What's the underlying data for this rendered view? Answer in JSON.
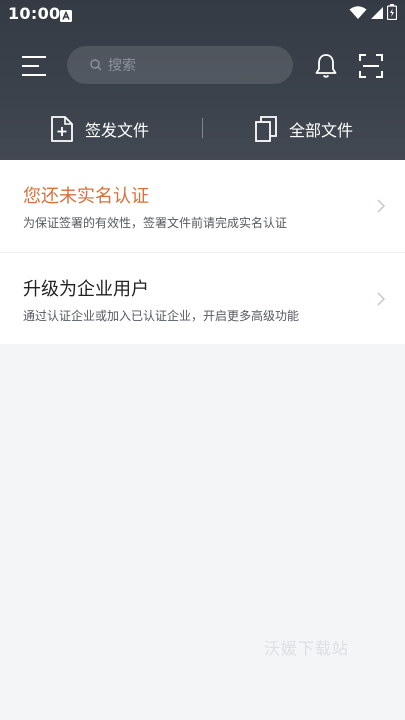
{
  "status_bar": {
    "time": "10:00",
    "icons": [
      "app-notification-icon",
      "wifi-icon",
      "signal-icon",
      "battery-icon"
    ]
  },
  "header": {
    "search_placeholder": "搜索",
    "icons": [
      "menu-icon",
      "search-icon",
      "bell-icon",
      "scan-icon"
    ]
  },
  "actions": {
    "sign_label": "签发文件",
    "all_files_label": "全部文件"
  },
  "cards": [
    {
      "title": "您还未实名认证",
      "subtitle": "为保证签署的有效性，签署文件前请完成实名认证"
    },
    {
      "title": "升级为企业用户",
      "subtitle": "通过认证企业或加入已认证企业，开启更多高级功能"
    }
  ],
  "watermark": "沃媛下载站",
  "colors": {
    "header_bg": "#3b424c",
    "warn_title": "#d7703a",
    "page_bg": "#f4f5f7"
  }
}
